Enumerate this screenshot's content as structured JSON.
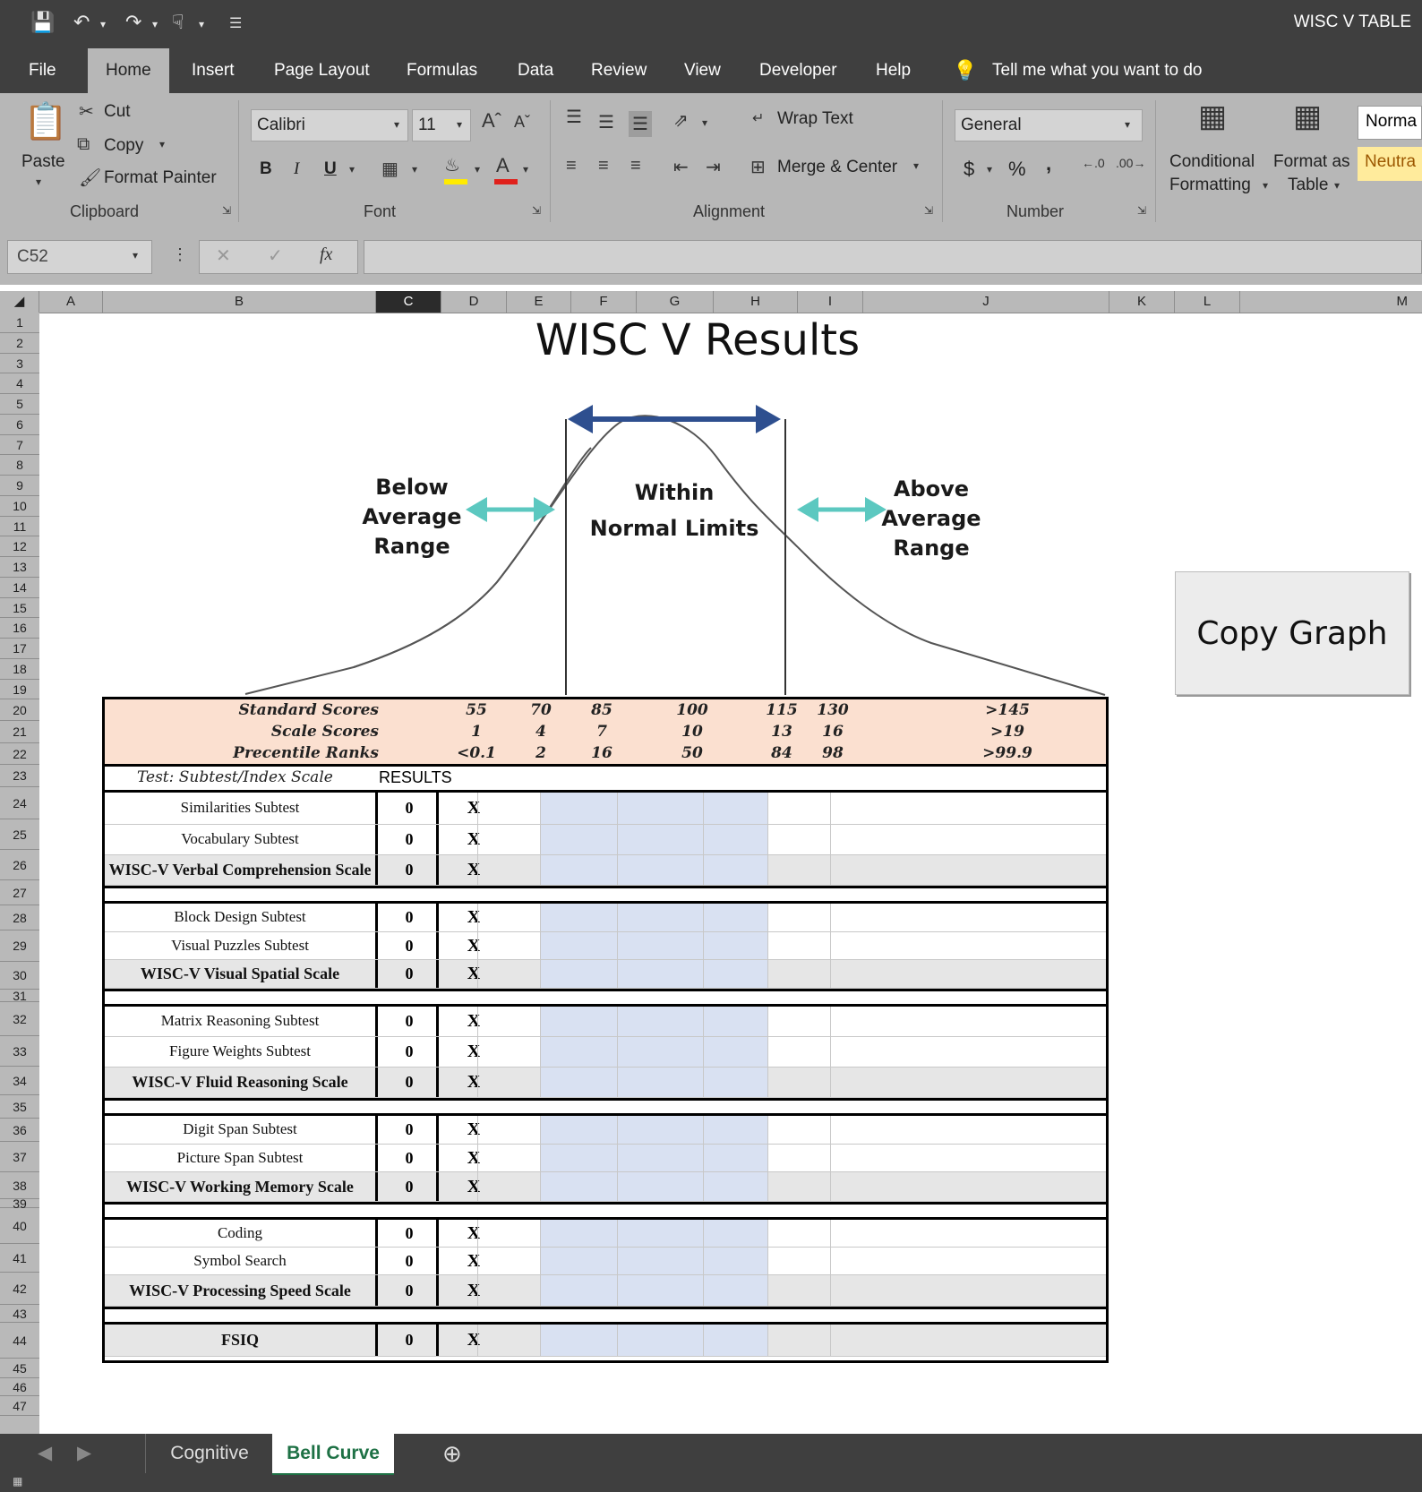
{
  "window": {
    "title": "WISC V TABLE",
    "quick_access": [
      "save-icon",
      "undo-icon",
      "redo-icon",
      "touch-mode-icon",
      "customize-icon"
    ]
  },
  "ribbon_tabs": [
    "File",
    "Home",
    "Insert",
    "Page Layout",
    "Formulas",
    "Data",
    "Review",
    "View",
    "Developer",
    "Help"
  ],
  "active_tab": "Home",
  "tell_me": "Tell me what you want to do",
  "clipboard": {
    "paste": "Paste",
    "cut": "Cut",
    "copy": "Copy",
    "format_painter": "Format Painter",
    "group": "Clipboard"
  },
  "font": {
    "name": "Calibri",
    "size": "11",
    "bold": "B",
    "italic": "I",
    "underline": "U",
    "group": "Font"
  },
  "alignment": {
    "wrap_text": "Wrap Text",
    "merge_center": "Merge & Center",
    "group": "Alignment"
  },
  "number": {
    "format": "General",
    "currency": "$",
    "percent": "%",
    "comma": ",",
    "group": "Number"
  },
  "styles": {
    "conditional_formatting_1": "Conditional",
    "conditional_formatting_2": "Formatting",
    "format_as_table_1": "Format as",
    "format_as_table_2": "Table",
    "normal": "Norma",
    "neutral": "Neutra"
  },
  "formula_bar": {
    "name_box": "C52",
    "formula": ""
  },
  "columns": [
    "A",
    "B",
    "C",
    "D",
    "E",
    "F",
    "G",
    "H",
    "I",
    "J",
    "K",
    "L",
    "M"
  ],
  "rows": [
    "1",
    "2",
    "3",
    "4",
    "5",
    "6",
    "7",
    "8",
    "9",
    "10",
    "11",
    "12",
    "13",
    "14",
    "15",
    "16",
    "17",
    "18",
    "19",
    "20",
    "21",
    "22",
    "23",
    "24",
    "25",
    "26",
    "27",
    "28",
    "29",
    "30",
    "31",
    "32",
    "33",
    "34",
    "35",
    "36",
    "37",
    "38",
    "39",
    "40",
    "41",
    "42",
    "43",
    "44",
    "45",
    "46",
    "47"
  ],
  "sheet": {
    "title": "WISC V Results",
    "below_1": "Below",
    "below_2": "Average",
    "below_3": "Range",
    "within_1": "Within",
    "within_2": "Normal Limits",
    "above_1": "Above",
    "above_2": "Average",
    "above_3": "Range",
    "copy_graph": "Copy Graph",
    "score_labels": [
      "Standard Scores",
      "Scale Scores",
      "Precentile Ranks"
    ],
    "standard_scores": [
      "55",
      "70",
      "85",
      "100",
      "115",
      "130",
      ">145"
    ],
    "scale_scores": [
      "1",
      "4",
      "7",
      "10",
      "13",
      "16",
      ">19"
    ],
    "percentile_ranks": [
      "<0.1",
      "2",
      "16",
      "50",
      "84",
      "98",
      ">99.9"
    ],
    "test_header": "Test: Subtest/Index Scale",
    "results_header": "RESULTS",
    "rows": [
      {
        "label": "Similarities Subtest",
        "value": "0",
        "mark": "X"
      },
      {
        "label": "Vocabulary Subtest",
        "value": "0",
        "mark": "X"
      },
      {
        "label": "WISC-V Verbal Comprehension Scale",
        "value": "0",
        "mark": "X"
      },
      {
        "label": "Block Design Subtest",
        "value": "0",
        "mark": "X"
      },
      {
        "label": "Visual Puzzles Subtest",
        "value": "0",
        "mark": "X"
      },
      {
        "label": "WISC-V Visual Spatial Scale",
        "value": "0",
        "mark": "X"
      },
      {
        "label": "Matrix Reasoning Subtest",
        "value": "0",
        "mark": "X"
      },
      {
        "label": "Figure Weights Subtest",
        "value": "0",
        "mark": "X"
      },
      {
        "label": "WISC-V Fluid Reasoning Scale",
        "value": "0",
        "mark": "X"
      },
      {
        "label": "Digit Span Subtest",
        "value": "0",
        "mark": "X"
      },
      {
        "label": "Picture Span Subtest",
        "value": "0",
        "mark": "X"
      },
      {
        "label": "WISC-V Working Memory Scale",
        "value": "0",
        "mark": "X"
      },
      {
        "label": "Coding",
        "value": "0",
        "mark": "X"
      },
      {
        "label": "Symbol Search",
        "value": "0",
        "mark": "X"
      },
      {
        "label": "WISC-V Processing Speed Scale",
        "value": "0",
        "mark": "X"
      },
      {
        "label": "FSIQ",
        "value": "0",
        "mark": "X"
      }
    ]
  },
  "sheet_tabs": [
    "Cognitive",
    "Bell Curve"
  ],
  "active_sheet": "Bell Curve",
  "colors": {
    "chrome_dark": "#3f3f3f",
    "ribbon": "#b7b7b7",
    "score_header": "#fbe0d0",
    "normal_band": "#d9e1f2",
    "scale_row": "#e6e6e6",
    "arrow_blue": "#2e4f8f",
    "arrow_teal": "#5cc8c0",
    "active_sheet_text": "#1e7145"
  }
}
